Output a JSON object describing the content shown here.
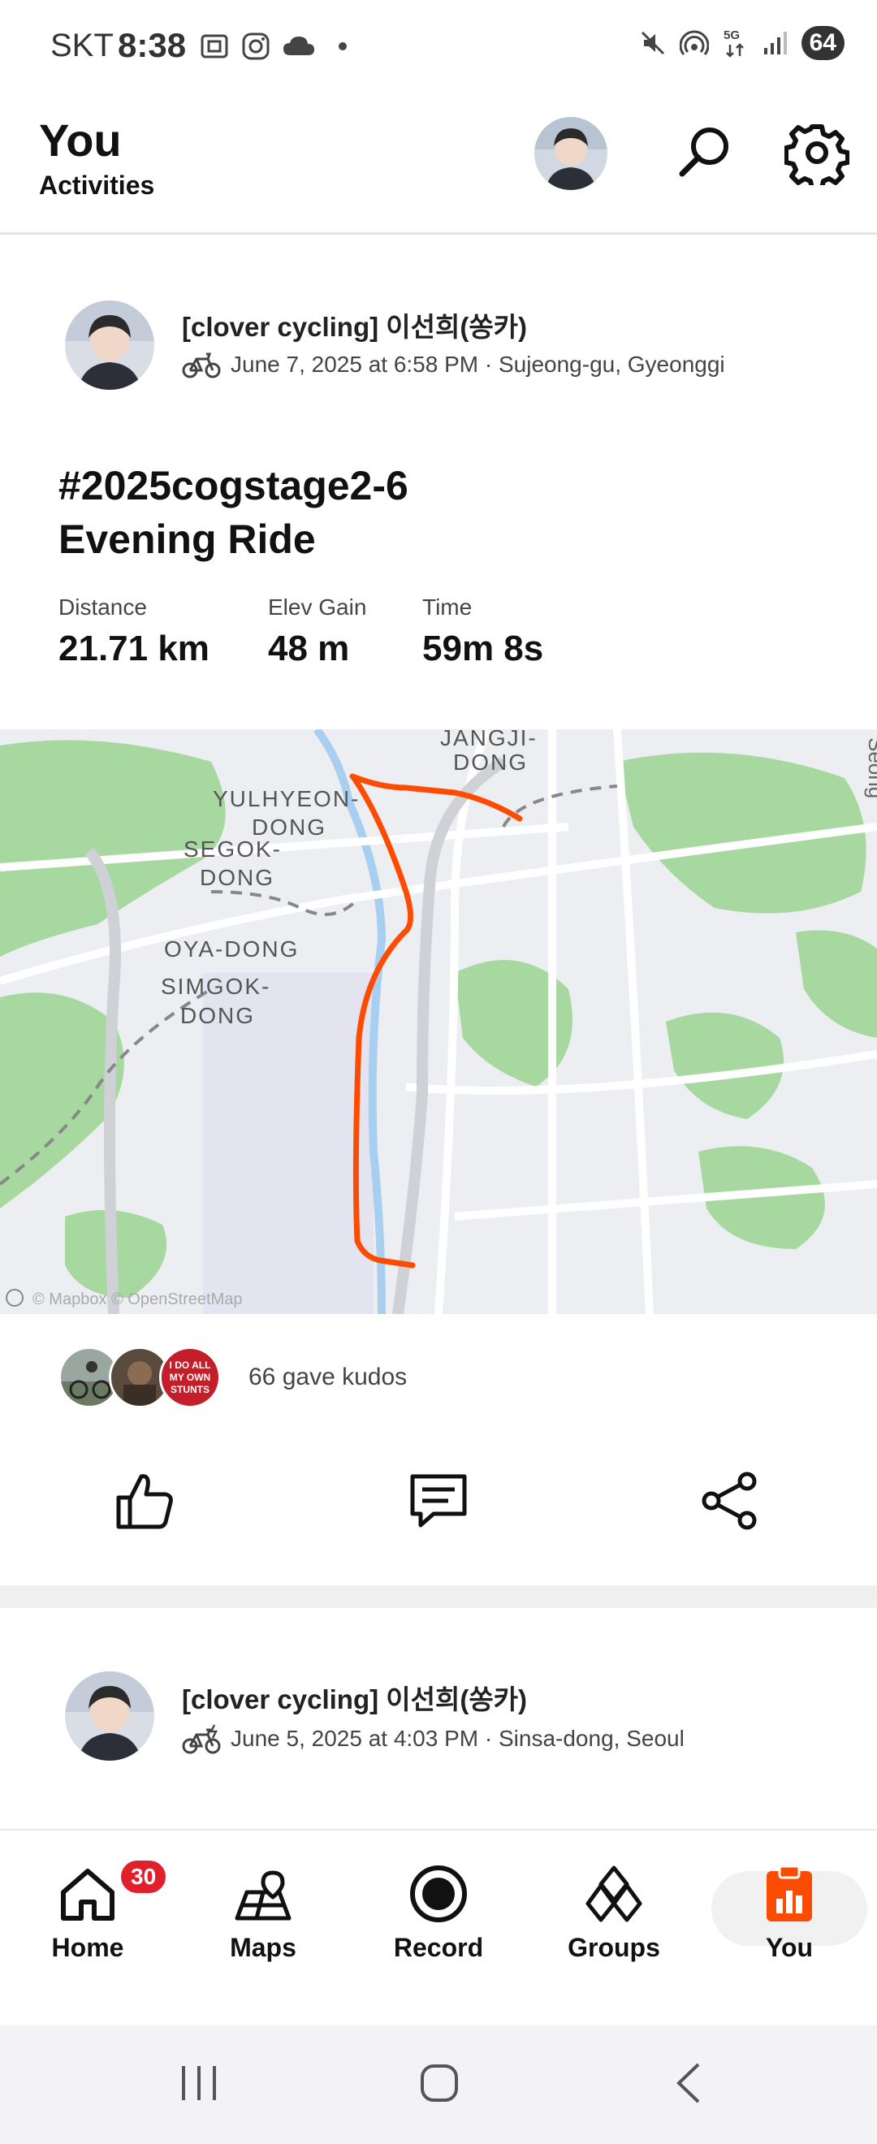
{
  "status_bar": {
    "carrier": "SKT",
    "time": "8:38",
    "battery": "64",
    "network": "5G"
  },
  "header": {
    "title": "You",
    "subtitle": "Activities"
  },
  "activities": [
    {
      "athlete": "[clover cycling] 이선희(쏭카)",
      "meta": "June 7, 2025 at 6:58 PM · Sujeong-gu, Gyeonggi",
      "title_line1": "#2025cogstage2-6",
      "title_line2": "Evening Ride",
      "stats": [
        {
          "label": "Distance",
          "value": "21.71 km"
        },
        {
          "label": "Elev Gain",
          "value": "48 m"
        },
        {
          "label": "Time",
          "value": "59m 8s"
        }
      ],
      "map": {
        "labels": [
          "JANGJI-\nDONG",
          "YULHYEON-",
          "DONG",
          "SEGOK-",
          "DONG",
          "OYA-DONG",
          "SIMGOK-",
          "DONG",
          "Seong"
        ],
        "attribution": "© Mapbox © OpenStreetMap",
        "route_color": "#fc4c02"
      },
      "kudos_text": "66 gave kudos",
      "kudos_avatar_text": "I DO ALL MY OWN STUNTS"
    },
    {
      "athlete": "[clover cycling] 이선희(쏭카)",
      "meta": "June 5, 2025 at 4:03 PM · Sinsa-dong, Seoul"
    }
  ],
  "bottom_nav": {
    "items": [
      {
        "label": "Home",
        "icon": "home-icon",
        "badge": "30"
      },
      {
        "label": "Maps",
        "icon": "maps-icon"
      },
      {
        "label": "Record",
        "icon": "record-icon"
      },
      {
        "label": "Groups",
        "icon": "groups-icon"
      },
      {
        "label": "You",
        "icon": "you-icon",
        "active_color": "#fc4c02"
      }
    ]
  }
}
